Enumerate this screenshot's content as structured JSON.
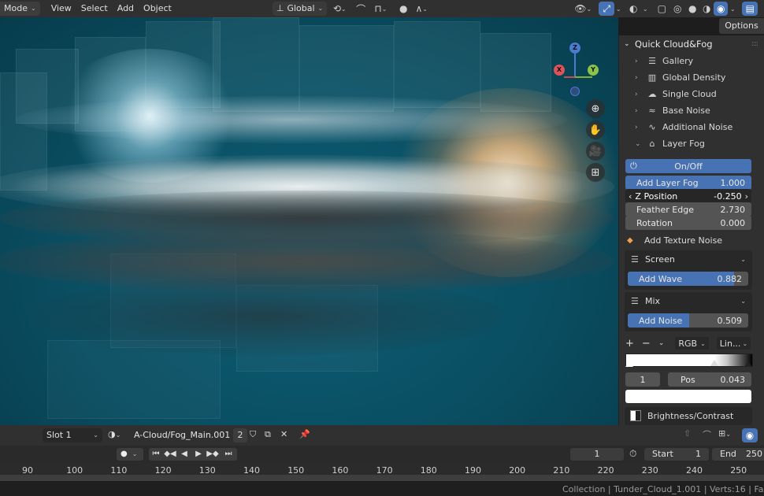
{
  "header": {
    "mode_label": "Mode",
    "menus": [
      "View",
      "Select",
      "Add",
      "Object"
    ],
    "orientation": "Global"
  },
  "viewport": {
    "gizmo": {
      "z": "Z",
      "x": "X",
      "y": "Y"
    }
  },
  "options_label": "Options",
  "sidebar": {
    "panel_title": "Quick Cloud&Fog",
    "items": [
      {
        "label": "Gallery",
        "icon": "list-icon"
      },
      {
        "label": "Global Density",
        "icon": "density-icon"
      },
      {
        "label": "Single Cloud",
        "icon": "cloud-icon"
      },
      {
        "label": "Base Noise",
        "icon": "wave-icon"
      },
      {
        "label": "Additional Noise",
        "icon": "noise-icon"
      }
    ],
    "layer_fog": {
      "label": "Layer Fog",
      "onoff_label": "On/Off",
      "add_layer_fog": {
        "label": "Add Layer Fog",
        "value": "1.000",
        "fill": 1.0
      },
      "z_position": {
        "label": "Z Position",
        "value": "-0.250"
      },
      "feather_edge": {
        "label": "Feather Edge",
        "value": "2.730"
      },
      "rotation": {
        "label": "Rotation",
        "value": "0.000"
      },
      "add_texture_noise": "Add Texture Noise",
      "screen_mode": "Screen",
      "add_wave": {
        "label": "Add Wave",
        "value": "0.882",
        "fill": 0.882
      },
      "mix_mode": "Mix",
      "add_noise": {
        "label": "Add Noise",
        "value": "0.509",
        "fill": 0.509
      },
      "color_mode": "RGB",
      "interp": "Lin...",
      "stop_index": "1",
      "pos_label": "Pos",
      "pos_value": "0.043",
      "brightness_label": "Brightness/Contrast"
    }
  },
  "timeline_header": {
    "slot": "Slot 1",
    "action_name": "A-Cloud/Fog_Main.001",
    "user_count": "2"
  },
  "playback": {
    "current_frame": "1",
    "start_label": "Start",
    "start_value": "1",
    "end_label": "End",
    "end_value": "250"
  },
  "ruler": [
    "90",
    "100",
    "110",
    "120",
    "130",
    "140",
    "150",
    "160",
    "170",
    "180",
    "190",
    "200",
    "210",
    "220",
    "230",
    "240",
    "250"
  ],
  "status": {
    "collection": "Collection",
    "object": "Tunder_Cloud_1.001",
    "verts": "Verts:16",
    "faces": "Faces"
  },
  "colors": {
    "accent": "#4772b3",
    "viewport_bg": "#0a5266",
    "warm_light": "#f6c48a",
    "cool_light": "#dff3ff"
  }
}
